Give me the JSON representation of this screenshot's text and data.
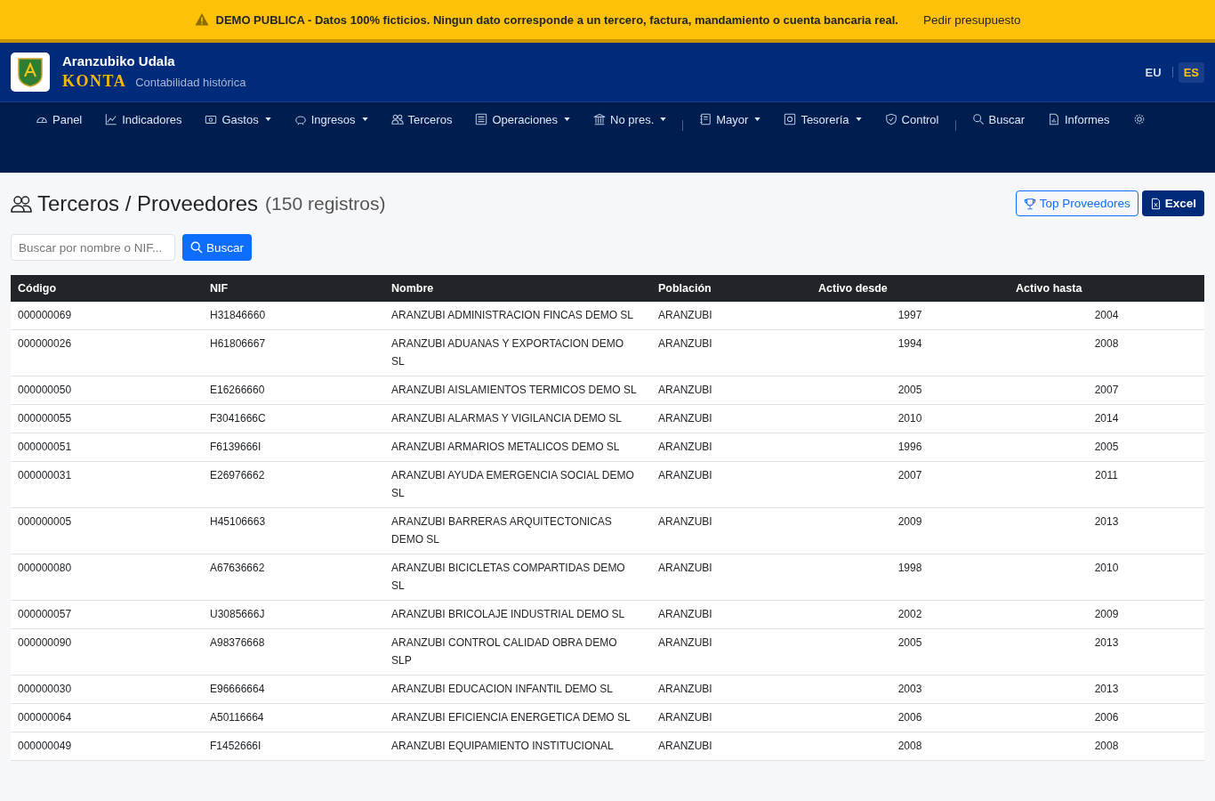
{
  "banner": {
    "message": "DEMO PUBLICA - Datos 100% ficticios. Ningun dato corresponde a un tercero, factura, mandamiento o cuenta bancaria real.",
    "link": "Pedir presupuesto"
  },
  "header": {
    "title": "Aranzubiko Udala",
    "brand": "KONTA",
    "subtitle": "Contabilidad histórica",
    "languages": [
      {
        "label": "EU",
        "selected": false
      },
      {
        "label": "ES",
        "selected": true
      }
    ]
  },
  "nav": [
    {
      "kind": "link",
      "label": "Panel"
    },
    {
      "kind": "link",
      "label": "Indicadores"
    },
    {
      "kind": "dropdown",
      "label": "Gastos"
    },
    {
      "kind": "dropdown",
      "label": "Ingresos"
    },
    {
      "kind": "link",
      "label": "Terceros"
    },
    {
      "kind": "dropdown",
      "label": "Operaciones"
    },
    {
      "kind": "dropdown",
      "label": "No pres."
    },
    {
      "kind": "separator"
    },
    {
      "kind": "dropdown",
      "label": "Mayor"
    },
    {
      "kind": "dropdown",
      "label": "Tesorería"
    },
    {
      "kind": "link",
      "label": "Control"
    },
    {
      "kind": "separator"
    },
    {
      "kind": "link",
      "label": "Buscar"
    },
    {
      "kind": "link",
      "label": "Informes"
    },
    {
      "kind": "settings"
    }
  ],
  "page": {
    "title": "Terceros / Proveedores",
    "count": "(150 registros)",
    "top_button": "Top Proveedores",
    "excel_button": "Excel",
    "search": {
      "placeholder": "Buscar por nombre o NIF..."
    },
    "search_button": "Buscar"
  },
  "table": {
    "columns": [
      "Código",
      "NIF",
      "Nombre",
      "Población",
      "Activo desde",
      "Activo hasta"
    ],
    "rows": [
      [
        "000000069",
        "H31846660",
        "ARANZUBI ADMINISTRACION FINCAS DEMO SL",
        "ARANZUBI",
        "1997",
        "2004"
      ],
      [
        "000000026",
        "H61806667",
        "ARANZUBI ADUANAS Y EXPORTACION DEMO SL",
        "ARANZUBI",
        "1994",
        "2008"
      ],
      [
        "000000050",
        "E16266660",
        "ARANZUBI AISLAMIENTOS TERMICOS DEMO SL",
        "ARANZUBI",
        "2005",
        "2007"
      ],
      [
        "000000055",
        "F3041666C",
        "ARANZUBI ALARMAS Y VIGILANCIA DEMO SL",
        "ARANZUBI",
        "2010",
        "2014"
      ],
      [
        "000000051",
        "F6139666I",
        "ARANZUBI ARMARIOS METALICOS DEMO SL",
        "ARANZUBI",
        "1996",
        "2005"
      ],
      [
        "000000031",
        "E26976662",
        "ARANZUBI AYUDA EMERGENCIA SOCIAL DEMO SL",
        "ARANZUBI",
        "2007",
        "2011"
      ],
      [
        "000000005",
        "H45106663",
        "ARANZUBI BARRERAS ARQUITECTONICAS DEMO SL",
        "ARANZUBI",
        "2009",
        "2013"
      ],
      [
        "000000080",
        "A67636662",
        "ARANZUBI BICICLETAS COMPARTIDAS DEMO SL",
        "ARANZUBI",
        "1998",
        "2010"
      ],
      [
        "000000057",
        "U3085666J",
        "ARANZUBI BRICOLAJE INDUSTRIAL DEMO SL",
        "ARANZUBI",
        "2002",
        "2009"
      ],
      [
        "000000090",
        "A98376668",
        "ARANZUBI CONTROL CALIDAD OBRA DEMO SLP",
        "ARANZUBI",
        "2005",
        "2013"
      ],
      [
        "000000030",
        "E96666664",
        "ARANZUBI EDUCACION INFANTIL DEMO SL",
        "ARANZUBI",
        "2003",
        "2013"
      ],
      [
        "000000064",
        "A50116664",
        "ARANZUBI EFICIENCIA ENERGETICA DEMO SL",
        "ARANZUBI",
        "2006",
        "2006"
      ],
      [
        "000000049",
        "F1452666I",
        "ARANZUBI EQUIPAMIENTO INSTITUCIONAL",
        "ARANZUBI",
        "2008",
        "2008"
      ]
    ]
  }
}
